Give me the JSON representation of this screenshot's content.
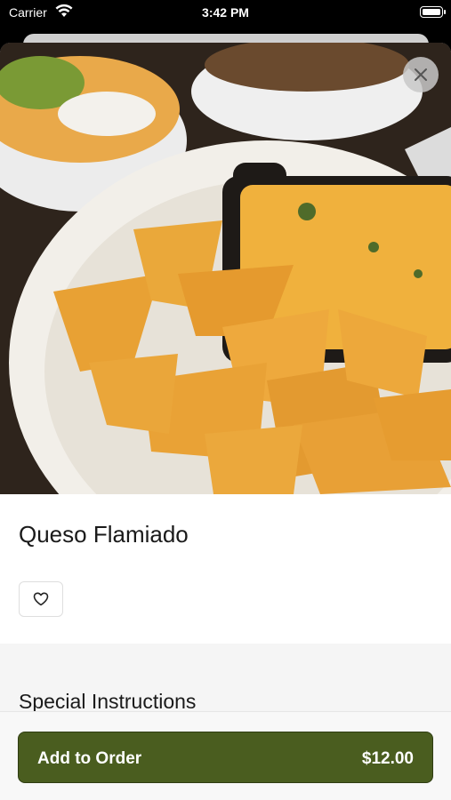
{
  "status_bar": {
    "carrier": "Carrier",
    "time": "3:42 PM"
  },
  "item": {
    "name": "Queso Flamiado",
    "image_alt": "queso dip with tortilla chips",
    "favorite_icon": "heart-icon"
  },
  "special_instructions": {
    "heading": "Special Instructions"
  },
  "order_button": {
    "label": "Add to Order",
    "price": "$12.00"
  },
  "colors": {
    "accent": "#4a5d1f",
    "accent_border": "#2f3d12",
    "close_bg": "#c8c8c8",
    "section_bg": "#f5f5f5"
  }
}
